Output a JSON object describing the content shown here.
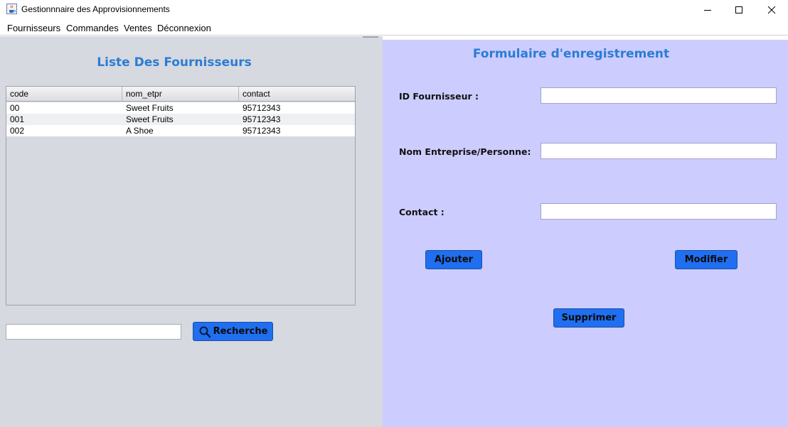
{
  "window": {
    "title": "Gestionnnaire des Approvisionnements",
    "icon": "java-cup-icon"
  },
  "menu": {
    "items": [
      "Fournisseurs",
      "Commandes",
      "Ventes",
      "Déconnexion"
    ]
  },
  "left": {
    "title": "Liste Des Fournisseurs",
    "table": {
      "columns": [
        "code",
        "nom_etpr",
        "contact"
      ],
      "rows": [
        [
          "00",
          "Sweet Fruits",
          "95712343"
        ],
        [
          "001",
          "Sweet Fruits",
          "95712343"
        ],
        [
          "002",
          "A Shoe",
          "95712343"
        ]
      ]
    },
    "search": {
      "value": "",
      "button_label": "Recherche",
      "button_icon": "search-icon"
    }
  },
  "right": {
    "title": "Formulaire d'enregistrement",
    "fields": [
      {
        "label": "ID Fournisseur :",
        "value": ""
      },
      {
        "label": "Nom Entreprise/Personne:",
        "value": ""
      },
      {
        "label": "Contact :",
        "value": ""
      }
    ],
    "buttons": {
      "add": "Ajouter",
      "modify": "Modifier",
      "delete": "Supprimer"
    }
  },
  "colors": {
    "accent": "#2b7cd3",
    "button": "#1f6ff0",
    "form_bg": "#ccccff",
    "list_bg": "#d6d9e0"
  }
}
